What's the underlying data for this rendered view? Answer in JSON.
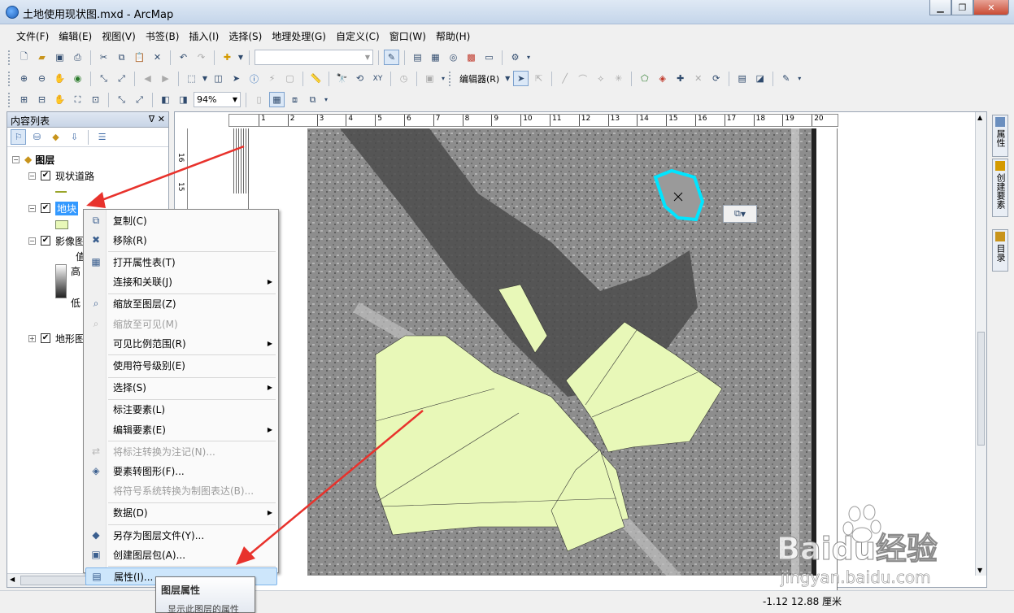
{
  "window": {
    "title": "土地使用现状图.mxd - ArcMap"
  },
  "menubar": [
    "文件(F)",
    "编辑(E)",
    "视图(V)",
    "书签(B)",
    "插入(I)",
    "选择(S)",
    "地理处理(G)",
    "自定义(C)",
    "窗口(W)",
    "帮助(H)"
  ],
  "toolbar2": {
    "editor_label": "编辑器(R)"
  },
  "toolbar3": {
    "zoom": "94%"
  },
  "toc": {
    "title": "内容列表",
    "header_buttons": "ᐁ ✕",
    "root": "图层",
    "layers": [
      {
        "name": "现状道路",
        "checked": true
      },
      {
        "name": "地块",
        "checked": true,
        "selected": true
      },
      {
        "name": "影像图",
        "checked": true,
        "legend_label": "值",
        "high": "高",
        "low": "低"
      },
      {
        "name": "地形图",
        "checked": true
      }
    ]
  },
  "context_menu": [
    {
      "label": "复制(C)",
      "icon": "copy-icon"
    },
    {
      "label": "移除(R)",
      "icon": "remove-icon"
    },
    {
      "label": "打开属性表(T)",
      "icon": "table-icon"
    },
    {
      "label": "连接和关联(J)",
      "submenu": true
    },
    {
      "label": "缩放至图层(Z)",
      "icon": "zoom-layer-icon"
    },
    {
      "label": "缩放至可见(M)",
      "disabled": true,
      "icon": "zoom-visible-icon"
    },
    {
      "label": "可见比例范围(R)",
      "submenu": true
    },
    {
      "label": "使用符号级别(E)"
    },
    {
      "label": "选择(S)",
      "submenu": true
    },
    {
      "label": "标注要素(L)"
    },
    {
      "label": "编辑要素(E)",
      "submenu": true
    },
    {
      "label": "将标注转换为注记(N)...",
      "disabled": true,
      "icon": "convert-icon"
    },
    {
      "label": "要素转图形(F)...",
      "icon": "graphics-icon"
    },
    {
      "label": "将符号系统转换为制图表达(B)...",
      "disabled": true
    },
    {
      "label": "数据(D)",
      "submenu": true
    },
    {
      "label": "另存为图层文件(Y)...",
      "icon": "layer-file-icon"
    },
    {
      "label": "创建图层包(A)...",
      "icon": "layer-package-icon"
    },
    {
      "label": "属性(I)...",
      "icon": "properties-icon",
      "hover": true
    }
  ],
  "tooltip": {
    "title": "图层属性",
    "desc": "显示此图层的属性"
  },
  "ruler_top": [
    "1",
    "2",
    "3",
    "4",
    "5",
    "6",
    "7",
    "8",
    "9",
    "10",
    "11",
    "12",
    "13",
    "14",
    "15",
    "16",
    "17",
    "18",
    "19",
    "20"
  ],
  "ruler_left": [
    "16",
    "15",
    "14"
  ],
  "right_dock": [
    "属性",
    "创建要素",
    "目录"
  ],
  "statusbar": {
    "coords": "-1.12  12.88 厘米"
  },
  "watermark": {
    "brand": "Baidu经验",
    "url": "jingyan.baidu.com"
  },
  "colors": {
    "parcel_fill": "#e8f8b8",
    "selection": "#00e5ff",
    "arrow": "#e8322c",
    "menu_hover": "#cde6fb"
  }
}
